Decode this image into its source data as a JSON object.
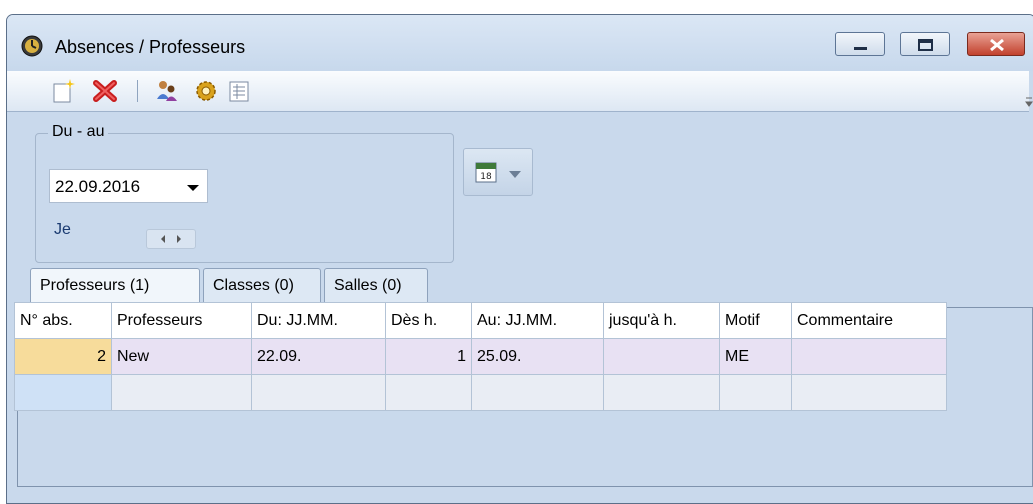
{
  "window": {
    "title": "Absences / Professeurs"
  },
  "toolbar": {
    "buttons": [
      {
        "name": "new-icon",
        "label": "new"
      },
      {
        "name": "delete-icon",
        "label": "delete"
      },
      {
        "name": "persons-icon",
        "label": "persons"
      },
      {
        "name": "settings-icon",
        "label": "settings"
      },
      {
        "name": "list-icon",
        "label": "list"
      }
    ]
  },
  "range": {
    "legend": "Du - au",
    "date": "22.09.2016",
    "day": "Je"
  },
  "tabs": [
    {
      "label": "Professeurs (1)",
      "active": true
    },
    {
      "label": "Classes (0)",
      "active": false
    },
    {
      "label": "Salles (0)",
      "active": false
    }
  ],
  "grid": {
    "columns": [
      "N° abs.",
      "Professeurs",
      "Du: JJ.MM.",
      "Dès h.",
      "Au: JJ.MM.",
      "jusqu'à h.",
      "Motif",
      "Commentaire"
    ],
    "rows": [
      [
        "2",
        "New",
        "22.09.",
        "1",
        "25.09.",
        "",
        "ME",
        ""
      ]
    ]
  },
  "colors": {
    "accent": "#c9d9ec",
    "selected_cell": "#f7dc9b",
    "row": "#e8e1f3"
  }
}
